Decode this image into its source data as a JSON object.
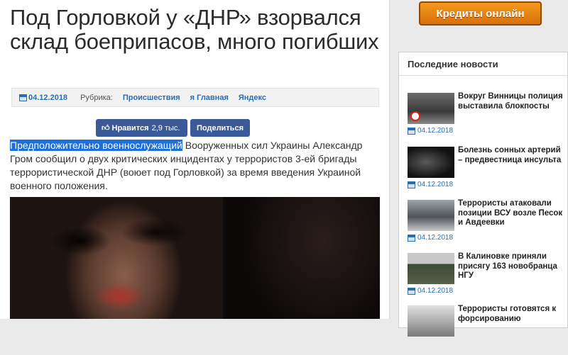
{
  "article": {
    "title": "Под Горловкой у «ДНР» взорвался склад боеприпасов, много погибших",
    "date": "04.12.2018",
    "rubric_label": "Рубрика:",
    "tags": [
      "Происшествия",
      "я Главная",
      "Яндекс"
    ],
    "like_label": "Нравится",
    "like_count": "2,9 тыс.",
    "share_label": "Поделиться",
    "highlighted_text": "Предположительно военнослужащий",
    "body_rest": " Вооруженных сил Украины Александр Гром сообщил о двух критических инцидентах у террористов 3-ей бригады террористической ДНР (воюет под Горловкой) за время введения Украиной военного положения."
  },
  "sidebar": {
    "credit_button": "Кредиты онлайн",
    "news_header": "Последние новости",
    "news": [
      {
        "title": "Вокруг Винницы полиция выставила блокпосты",
        "date": "04.12.2018"
      },
      {
        "title": "Болезнь сонных артерий – предвестница инсульта",
        "date": "04.12.2018"
      },
      {
        "title": "Террористы атаковали позиции ВСУ возле Песок и Авдеевки",
        "date": "04.12.2018"
      },
      {
        "title": "В Калиновке приняли присягу 163 новобранца НГУ",
        "date": "04.12.2018"
      },
      {
        "title": "Террористы готовятся к форсированию",
        "date": ""
      }
    ]
  },
  "colors": {
    "accent": "#2a6eb0",
    "facebook": "#3b5a9a",
    "cta": "#e8860f",
    "highlight": "#1e6fd9"
  }
}
